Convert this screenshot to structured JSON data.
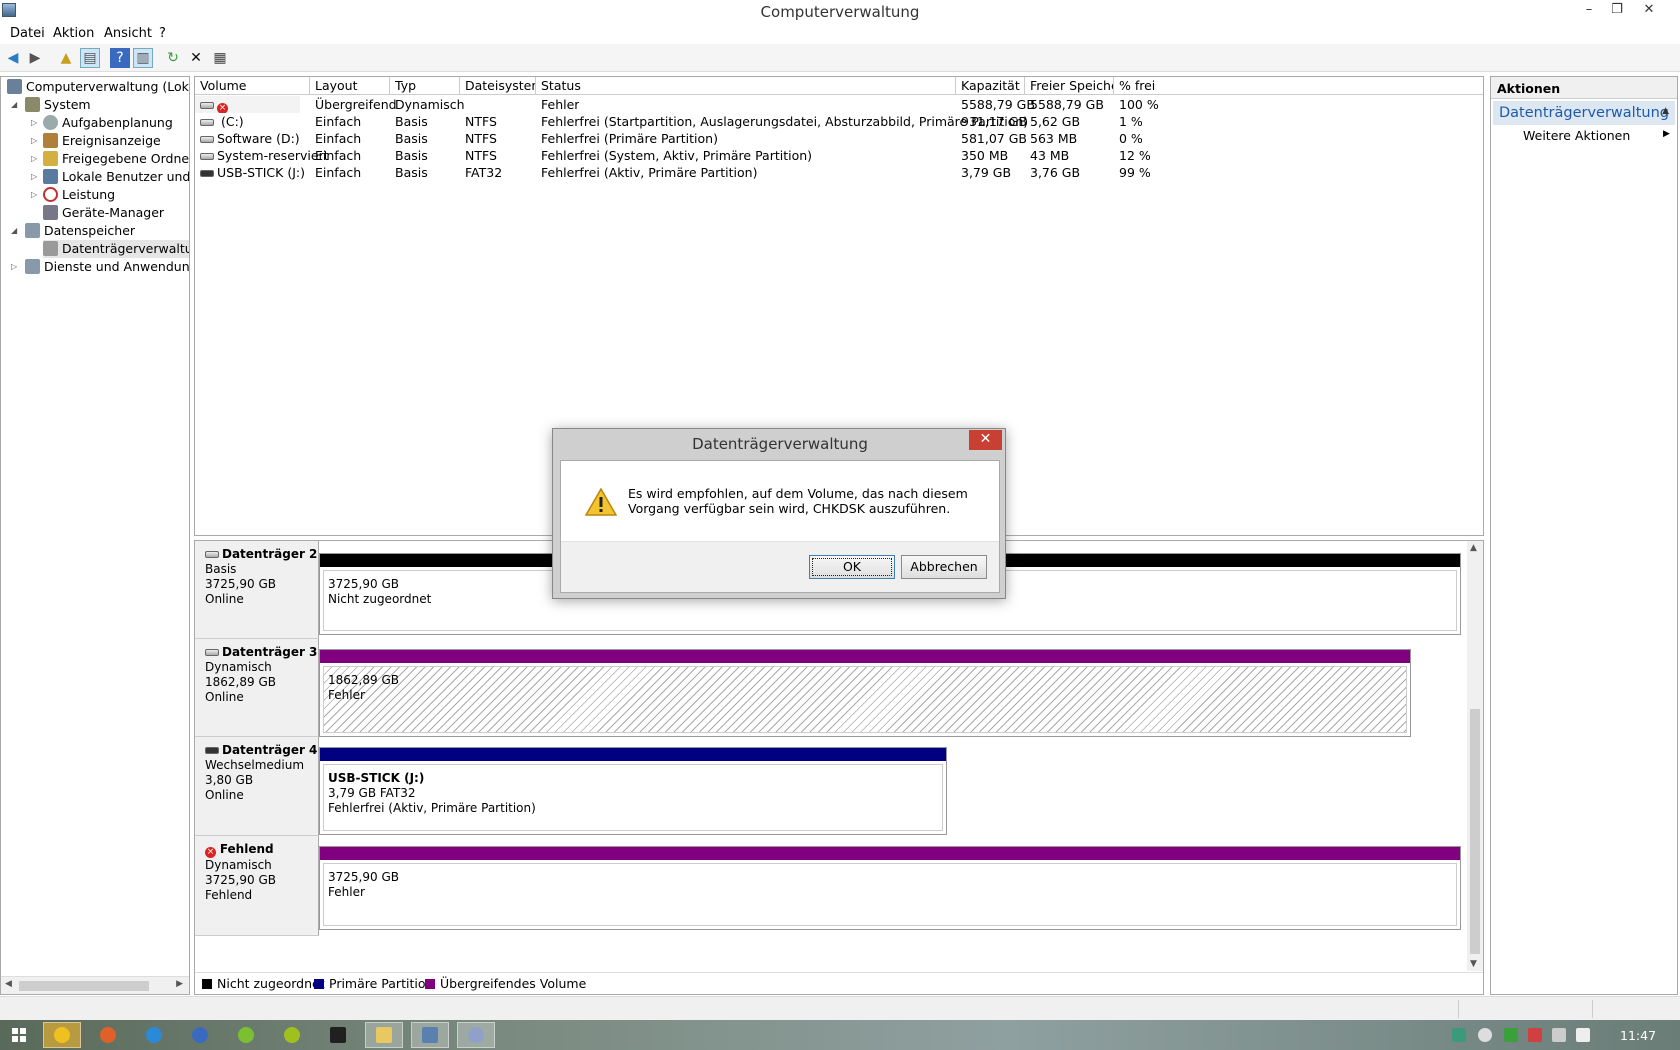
{
  "window": {
    "title": "Computerverwaltung",
    "minimize": "–",
    "restore": "❐",
    "close": "✕"
  },
  "menu": {
    "items": [
      "Datei",
      "Aktion",
      "Ansicht",
      "?"
    ]
  },
  "tree": {
    "items": [
      {
        "label": "Computerverwaltung (Lokal)",
        "icon": "computer-icon",
        "color": "#6a7f99"
      },
      {
        "label": "System",
        "icon": "tools-icon",
        "color": "#8a8a6a"
      },
      {
        "label": "Aufgabenplanung",
        "icon": "clock-icon",
        "color": "#9aa"
      },
      {
        "label": "Ereignisanzeige",
        "icon": "event-viewer-icon",
        "color": "#b0803a"
      },
      {
        "label": "Freigegebene Ordner",
        "icon": "shared-folder-icon",
        "color": "#d4b040"
      },
      {
        "label": "Lokale Benutzer und Gru",
        "icon": "users-icon",
        "color": "#5a7aa0"
      },
      {
        "label": "Leistung",
        "icon": "performance-icon",
        "color": "#c03030"
      },
      {
        "label": "Geräte-Manager",
        "icon": "device-manager-icon",
        "color": "#778"
      },
      {
        "label": "Datenspeicher",
        "icon": "storage-icon",
        "color": "#8899aa"
      },
      {
        "label": "Datenträgerverwaltung",
        "icon": "disk-management-icon",
        "color": "#9a9a9a"
      },
      {
        "label": "Dienste und Anwendungen",
        "icon": "services-icon",
        "color": "#8899aa"
      }
    ]
  },
  "volumes": {
    "columns": [
      "Volume",
      "Layout",
      "Typ",
      "Dateisystem",
      "Status",
      "Kapazität",
      "Freier Speicher",
      "% frei"
    ],
    "rows": [
      [
        "",
        "Übergreifend",
        "Dynamisch",
        "",
        "Fehler",
        "5588,79 GB",
        "5588,79 GB",
        "100 %"
      ],
      [
        "(C:)",
        "Einfach",
        "Basis",
        "NTFS",
        "Fehlerfrei (Startpartition, Auslagerungsdatei, Absturzabbild, Primäre Partition)",
        "931,17 GB",
        "5,62 GB",
        "1 %"
      ],
      [
        "Software (D:)",
        "Einfach",
        "Basis",
        "NTFS",
        "Fehlerfrei (Primäre Partition)",
        "581,07 GB",
        "563 MB",
        "0 %"
      ],
      [
        "System-reserviert",
        "Einfach",
        "Basis",
        "NTFS",
        "Fehlerfrei (System, Aktiv, Primäre Partition)",
        "350 MB",
        "43 MB",
        "12 %"
      ],
      [
        "USB-STICK (J:)",
        "Einfach",
        "Basis",
        "FAT32",
        "Fehlerfrei (Aktiv, Primäre Partition)",
        "3,79 GB",
        "3,76 GB",
        "99 %"
      ]
    ]
  },
  "disks": [
    {
      "name": "Datenträger 2",
      "type": "Basis",
      "size": "3725,90 GB",
      "state": "Online",
      "part": {
        "line1": "",
        "line2": "3725,90 GB",
        "line3": "Nicht zugeordnet"
      }
    },
    {
      "name": "Datenträger 3",
      "type": "Dynamisch",
      "size": "1862,89 GB",
      "state": "Online",
      "part": {
        "line1": "",
        "line2": "1862,89 GB",
        "line3": "Fehler"
      }
    },
    {
      "name": "Datenträger 4",
      "type": "Wechselmedium",
      "size": "3,80 GB",
      "state": "Online",
      "part": {
        "line1": "USB-STICK  (J:)",
        "line2": "3,79 GB FAT32",
        "line3": "Fehlerfrei (Aktiv, Primäre Partition)"
      }
    },
    {
      "name": "Fehlend",
      "type": "Dynamisch",
      "size": "3725,90 GB",
      "state": "Fehlend",
      "part": {
        "line1": "",
        "line2": "3725,90 GB",
        "line3": "Fehler"
      }
    }
  ],
  "legend": {
    "items": [
      {
        "label": "Nicht zugeordnet",
        "color": "#000000"
      },
      {
        "label": "Primäre Partition",
        "color": "#000080"
      },
      {
        "label": "Übergreifendes Volume",
        "color": "#800080"
      }
    ]
  },
  "actions": {
    "header": "Aktionen",
    "selected": "Datenträgerverwaltung",
    "more": "Weitere Aktionen"
  },
  "dialog": {
    "title": "Datenträgerverwaltung",
    "message": "Es wird empfohlen, auf dem Volume, das nach diesem Vorgang verfügbar sein wird, CHKDSK auszuführen.",
    "ok": "OK",
    "cancel": "Abbrechen"
  },
  "taskbar": {
    "apps": [
      {
        "name": "start-icon",
        "color": "#ffffff"
      },
      {
        "name": "norton-icon",
        "color": "#f0c020"
      },
      {
        "name": "firefox-icon",
        "color": "#e0602a"
      },
      {
        "name": "internet-explorer-icon",
        "color": "#2a8ad8"
      },
      {
        "name": "thunderbird-icon",
        "color": "#3a6ac0"
      },
      {
        "name": "utorrent-icon",
        "color": "#7ac030"
      },
      {
        "name": "quicken-icon",
        "color": "#a0c020"
      },
      {
        "name": "fup-icon",
        "color": "#202020"
      },
      {
        "name": "explorer-icon",
        "color": "#e8c860"
      },
      {
        "name": "computer-management-icon",
        "color": "#5a80b0"
      },
      {
        "name": "disk-tool-icon",
        "color": "#90a0c8"
      }
    ],
    "clock": "11:47"
  }
}
